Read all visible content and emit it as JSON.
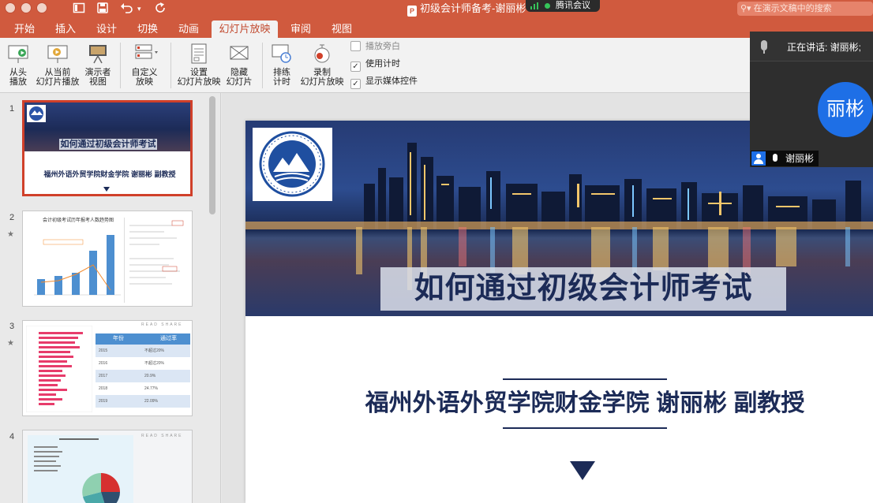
{
  "window": {
    "title": "初级会计师备考-谢丽彬",
    "file_badge": "P",
    "search_placeholder": "在演示文稿中的搜索",
    "meeting_app": "腾讯会议"
  },
  "tabs": [
    {
      "label": "开始",
      "active": false
    },
    {
      "label": "插入",
      "active": false
    },
    {
      "label": "设计",
      "active": false
    },
    {
      "label": "切换",
      "active": false
    },
    {
      "label": "动画",
      "active": false
    },
    {
      "label": "幻灯片放映",
      "active": true
    },
    {
      "label": "审阅",
      "active": false
    },
    {
      "label": "视图",
      "active": false
    }
  ],
  "ribbon": {
    "from_start": "从头\n播放",
    "from_current": "从当前\n幻灯片播放",
    "presenter_view": "演示者\n视图",
    "custom_show": "自定义\n放映",
    "setup_show": "设置\n幻灯片放映",
    "hide_slide": "隐藏\n幻灯片",
    "rehearse": "排练\n计时",
    "record": "录制\n幻灯片放映",
    "chk_narration": "播放旁白",
    "chk_timing": "使用计时",
    "chk_media": "显示媒体控件"
  },
  "thumbnails": [
    {
      "num": "1",
      "title": "如何通过初级会计师考试",
      "subtitle": "福州外语外贸学院财金学院 谢丽彬 副教授"
    },
    {
      "num": "2",
      "chart_title": "会计初级考试历年报考人数趋势图"
    },
    {
      "num": "3",
      "col_year": "年份",
      "col_rate": "通过率",
      "watermark": "READ   SHARE",
      "rows": [
        [
          "2015",
          "不超过20%"
        ],
        [
          "2016",
          "不超过20%"
        ],
        [
          "2017",
          "20.9%"
        ],
        [
          "2018",
          "24.77%"
        ],
        [
          "2019",
          "22.09%"
        ]
      ]
    },
    {
      "num": "4",
      "watermark": "READ   SHARE"
    }
  ],
  "slide": {
    "title": "如何通过初级会计师考试",
    "subtitle": "福州外语外贸学院财金学院 谢丽彬 副教授"
  },
  "meeting": {
    "speaking": "正在讲话: 谢丽彬;",
    "avatar_text": "丽彬",
    "participant": "谢丽彬"
  },
  "colors": {
    "titlebar": "#d05a3e",
    "slide_navy": "#1c2b57",
    "meeting_blue": "#1e6fe6",
    "selection_red": "#d0402a"
  }
}
